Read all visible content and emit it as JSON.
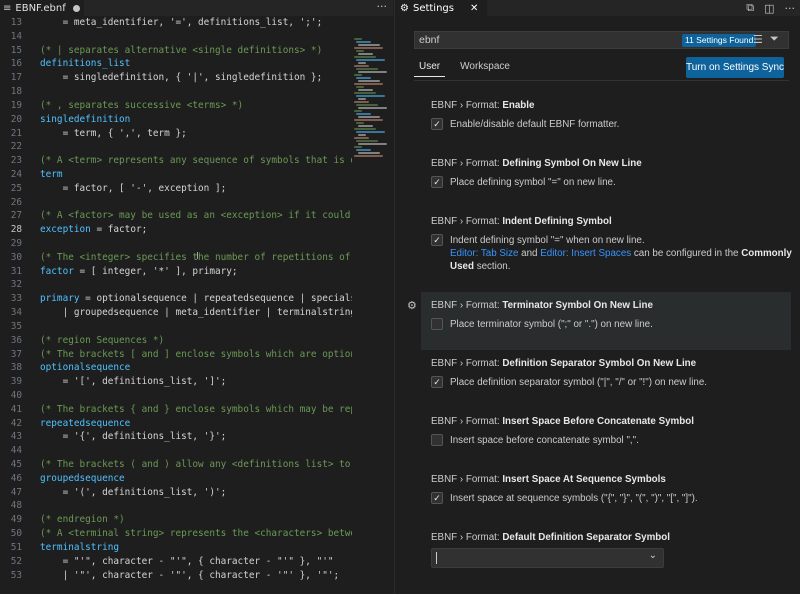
{
  "editor": {
    "tab_label": "EBNF.ebnf",
    "more_label": "···",
    "lines": [
      {
        "n": "13",
        "t": "    = meta_identifier, '=', definitions_list, ';';",
        "k": "def"
      },
      {
        "n": "14",
        "t": "",
        "k": "def"
      },
      {
        "n": "15",
        "t": "(* | separates alternative <single definitions> *)",
        "k": "cmt"
      },
      {
        "n": "16",
        "t": "definitions_list",
        "k": "id"
      },
      {
        "n": "17",
        "t": "    = singledefinition, { '|', singledefinition };",
        "k": "def"
      },
      {
        "n": "18",
        "t": "",
        "k": "def"
      },
      {
        "n": "19",
        "t": "(* , separates successive <terms> *)",
        "k": "cmt"
      },
      {
        "n": "20",
        "t": "singledefinition",
        "k": "id"
      },
      {
        "n": "21",
        "t": "    = term, { ',', term };",
        "k": "def"
      },
      {
        "n": "22",
        "t": "",
        "k": "def"
      },
      {
        "n": "23",
        "t": "(* A <term> represents any sequence of symbols that is d",
        "k": "cmt"
      },
      {
        "n": "24",
        "t": "term",
        "k": "id"
      },
      {
        "n": "25",
        "t": "    = factor, [ '-', exception ];",
        "k": "def"
      },
      {
        "n": "26",
        "t": "",
        "k": "def"
      },
      {
        "n": "27",
        "t": "(* A <factor> may be used as an <exception> if it could",
        "k": "cmt"
      },
      {
        "n": "28",
        "t": "exception = factor;",
        "k": "mix1"
      },
      {
        "n": "29",
        "t": "",
        "k": "def"
      },
      {
        "n": "30",
        "t": "(* The <integer> specifies the number of repetitions of",
        "k": "cmt"
      },
      {
        "n": "31",
        "t": "factor = [ integer, '*' ], primary;",
        "k": "mix2"
      },
      {
        "n": "32",
        "t": "",
        "k": "def"
      },
      {
        "n": "33",
        "t": "primary = optionalsequence | repeatedsequence | specials",
        "k": "mix3"
      },
      {
        "n": "34",
        "t": "    | groupedsequence | meta_identifier | terminalstring",
        "k": "def"
      },
      {
        "n": "35",
        "t": "",
        "k": "def"
      },
      {
        "n": "36",
        "t": "(* region Sequences *)",
        "k": "cmt"
      },
      {
        "n": "37",
        "t": "(* The brackets [ and ] enclose symbols which are option",
        "k": "cmt"
      },
      {
        "n": "38",
        "t": "optionalsequence",
        "k": "id"
      },
      {
        "n": "39",
        "t": "    = '[', definitions_list, ']';",
        "k": "def"
      },
      {
        "n": "40",
        "t": "",
        "k": "def"
      },
      {
        "n": "41",
        "t": "(* The brackets { and } enclose symbols which may be rep",
        "k": "cmt"
      },
      {
        "n": "42",
        "t": "repeatedsequence",
        "k": "id"
      },
      {
        "n": "43",
        "t": "    = '{', definitions_list, '}';",
        "k": "def"
      },
      {
        "n": "44",
        "t": "",
        "k": "def"
      },
      {
        "n": "45",
        "t": "(* The brackets ( and ) allow any <definitions list> to",
        "k": "cmt"
      },
      {
        "n": "46",
        "t": "groupedsequence",
        "k": "id"
      },
      {
        "n": "47",
        "t": "    = '(', definitions_list, ')';",
        "k": "def"
      },
      {
        "n": "48",
        "t": "",
        "k": "def"
      },
      {
        "n": "49",
        "t": "(* endregion *)",
        "k": "cmt"
      },
      {
        "n": "50",
        "t": "(* A <terminal string> represents the <characters> betwe",
        "k": "cmt"
      },
      {
        "n": "51",
        "t": "terminalstring",
        "k": "id"
      },
      {
        "n": "52",
        "t": "    = \"'\", character - \"'\", { character - \"'\" }, \"'\"",
        "k": "def"
      },
      {
        "n": "53",
        "t": "    | '\"', character - '\"', { character - '\"' }, '\"';",
        "k": "def"
      }
    ],
    "current_line": "28"
  },
  "settings": {
    "tab_label": "Settings",
    "close_label": "✕",
    "search_value": "ebnf",
    "found_badge": "11 Settings Found",
    "scope_tabs": [
      "User",
      "Workspace"
    ],
    "sync_button": "Turn on Settings Sync",
    "items": [
      {
        "cat": "EBNF › Format: ",
        "name": "Enable",
        "desc": "Enable/disable default EBNF formatter.",
        "checked": true
      },
      {
        "cat": "EBNF › Format: ",
        "name": "Defining Symbol On New Line",
        "desc": "Place defining symbol \"=\" on new line.",
        "checked": true
      },
      {
        "cat": "EBNF › Format: ",
        "name": "Indent Defining Symbol",
        "desc": "Indent defining symbol \"=\" when on new line.",
        "checked": true,
        "extra": {
          "link1": "Editor: Tab Size",
          "and": " and ",
          "link2": "Editor: Insert Spaces",
          "rest": " can be configured in the ",
          "bold1": "Commonly",
          "bold2": "Used",
          "tail": " section."
        }
      },
      {
        "cat": "EBNF › Format: ",
        "name": "Terminator Symbol On New Line",
        "desc": "Place terminator symbol (\";\" or \".\") on new line.",
        "checked": false
      },
      {
        "cat": "EBNF › Format: ",
        "name": "Definition Separator Symbol On New Line",
        "desc": "Place definition separator symbol (\"|\", \"/\" or \"!\") on new line.",
        "checked": true
      },
      {
        "cat": "EBNF › Format: ",
        "name": "Insert Space Before Concatenate Symbol",
        "desc": "Insert space before concatenate symbol \",\".",
        "checked": false
      },
      {
        "cat": "EBNF › Format: ",
        "name": "Insert Space At Sequence Symbols",
        "desc": "Insert space at sequence symbols (\"{\", \"}\", \"(\", \")\", \"[\", \"]\").",
        "checked": true
      },
      {
        "cat": "EBNF › Format: ",
        "name": "Default Definition Separator Symbol",
        "desc": "",
        "select_value": ""
      }
    ]
  },
  "colors": {
    "accent": "#0e639c",
    "link": "#3794ff",
    "comment": "#6a9955",
    "identifier": "#4fc1ff"
  },
  "icons": [
    "file-icon",
    "more-actions-icon",
    "settings-gear-icon",
    "close-icon",
    "open-json-icon",
    "split-editor-icon",
    "clear-filter-icon",
    "filter-icon",
    "checkbox-check-icon",
    "chevron-down-icon"
  ]
}
